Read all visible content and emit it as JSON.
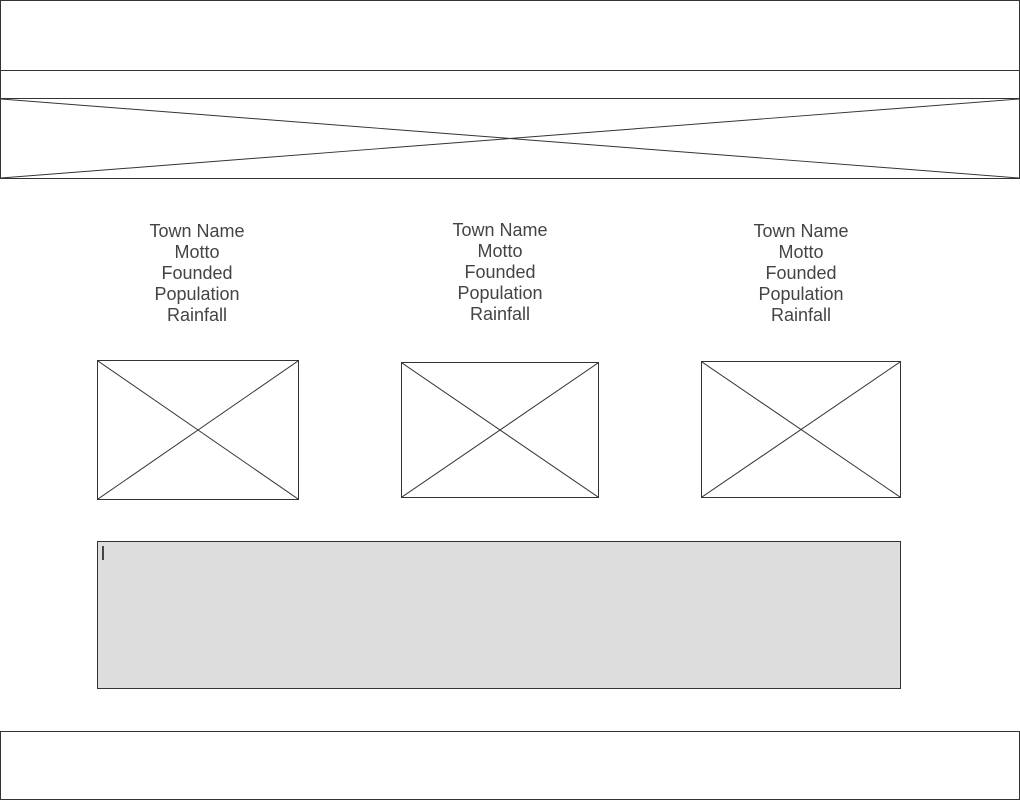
{
  "header": {},
  "nav": {},
  "hero": {
    "icon": "image-placeholder-icon"
  },
  "towns": [
    {
      "name": "Town Name",
      "motto": "Motto",
      "founded": "Founded",
      "population": "Population",
      "rainfall": "Rainfall",
      "image_icon": "image-placeholder-icon"
    },
    {
      "name": "Town Name",
      "motto": "Motto",
      "founded": "Founded",
      "population": "Population",
      "rainfall": "Rainfall",
      "image_icon": "image-placeholder-icon"
    },
    {
      "name": "Town Name",
      "motto": "Motto",
      "founded": "Founded",
      "population": "Population",
      "rainfall": "Rainfall",
      "image_icon": "image-placeholder-icon"
    }
  ],
  "text_area": {
    "value": ""
  },
  "footer": {},
  "colors": {
    "outline": "#333333",
    "text": "#444444",
    "text_area_fill": "#dddddd",
    "background": "#ffffff"
  }
}
